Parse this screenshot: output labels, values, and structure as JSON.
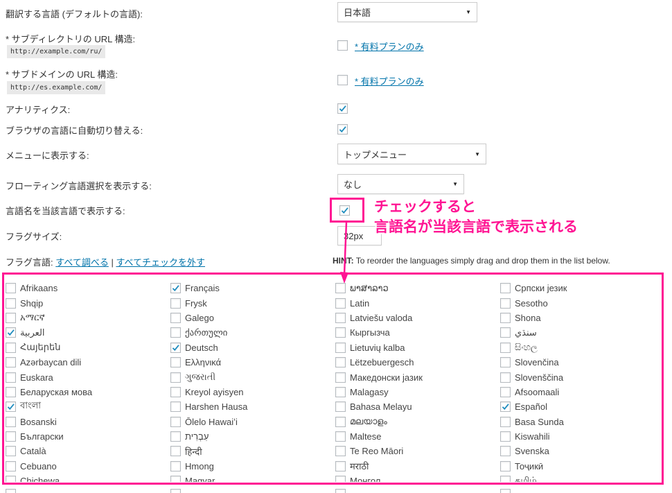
{
  "settings": {
    "translate_language": {
      "label": "翻訳する言語 (デフォルトの言語):",
      "value": "日本語"
    },
    "subdirectory": {
      "label": "* サブディレクトリの URL 構造:",
      "example": "http://example.com/ru/",
      "link": "* 有料プランのみ"
    },
    "subdomain": {
      "label": "* サブドメインの URL 構造:",
      "example": "http://es.example.com/",
      "link": "* 有料プランのみ"
    },
    "analytics": {
      "label": "アナリティクス:",
      "checked": true
    },
    "auto_switch": {
      "label": "ブラウザの言語に自動切り替える:",
      "checked": true
    },
    "menu_display": {
      "label": "メニューに表示する:",
      "value": "トップメニュー"
    },
    "floating": {
      "label": "フローティング言語選択を表示する:",
      "value": "なし"
    },
    "native_names": {
      "label": "言語名を当該言語で表示する:",
      "checked": true
    },
    "flag_size": {
      "label": "フラグサイズ:",
      "value": "32px"
    },
    "flag_languages": {
      "label": "フラグ言語:",
      "check_all": "すべて調べる",
      "separator": " | ",
      "uncheck_all": "すべてチェックを外す"
    },
    "hint": {
      "prefix": "HINT:",
      "text": " To reorder the languages simply drag and drop them in the list below."
    }
  },
  "annotation": {
    "line1": "チェックすると",
    "line2": "言語名が当該言語で表示される",
    "color": "#ff1493"
  },
  "languages": {
    "col1": [
      {
        "name": "Afrikaans",
        "checked": false
      },
      {
        "name": "Shqip",
        "checked": false
      },
      {
        "name": "አማርኛ",
        "checked": false
      },
      {
        "name": "العربية",
        "checked": true
      },
      {
        "name": "Հայերեն",
        "checked": false
      },
      {
        "name": "Azərbaycan dili",
        "checked": false
      },
      {
        "name": "Euskara",
        "checked": false
      },
      {
        "name": "Беларуская мова",
        "checked": false
      },
      {
        "name": "বাংলা",
        "checked": true
      },
      {
        "name": "Bosanski",
        "checked": false
      },
      {
        "name": "Български",
        "checked": false
      },
      {
        "name": "Català",
        "checked": false
      },
      {
        "name": "Cebuano",
        "checked": false
      },
      {
        "name": "Chichewa",
        "checked": false
      }
    ],
    "col2": [
      {
        "name": "Français",
        "checked": true
      },
      {
        "name": "Frysk",
        "checked": false
      },
      {
        "name": "Galego",
        "checked": false
      },
      {
        "name": "ქართული",
        "checked": false
      },
      {
        "name": "Deutsch",
        "checked": true
      },
      {
        "name": "Ελληνικά",
        "checked": false
      },
      {
        "name": "ગુજરાતી",
        "checked": false
      },
      {
        "name": "Kreyol ayisyen",
        "checked": false
      },
      {
        "name": "Harshen Hausa",
        "checked": false
      },
      {
        "name": "Ōlelo Hawaiʻi",
        "checked": false
      },
      {
        "name": "עִבְרִית",
        "checked": false
      },
      {
        "name": "हिन्दी",
        "checked": false
      },
      {
        "name": "Hmong",
        "checked": false
      },
      {
        "name": "Magyar",
        "checked": false
      }
    ],
    "col3": [
      {
        "name": "ພາສາລາວ",
        "checked": false
      },
      {
        "name": "Latin",
        "checked": false
      },
      {
        "name": "Latviešu valoda",
        "checked": false
      },
      {
        "name": "Кыргызча",
        "checked": false
      },
      {
        "name": "Lietuvių kalba",
        "checked": false
      },
      {
        "name": "Lëtzebuergesch",
        "checked": false
      },
      {
        "name": "Македонски јазик",
        "checked": false
      },
      {
        "name": "Malagasy",
        "checked": false
      },
      {
        "name": "Bahasa Melayu",
        "checked": false
      },
      {
        "name": "മലയാളം",
        "checked": false
      },
      {
        "name": "Maltese",
        "checked": false
      },
      {
        "name": "Te Reo Māori",
        "checked": false
      },
      {
        "name": "मराठी",
        "checked": false
      },
      {
        "name": "Монгол",
        "checked": false
      }
    ],
    "col4": [
      {
        "name": "Српски језик",
        "checked": false
      },
      {
        "name": "Sesotho",
        "checked": false
      },
      {
        "name": "Shona",
        "checked": false
      },
      {
        "name": "سنڌي",
        "checked": false
      },
      {
        "name": "සිංහල",
        "checked": false
      },
      {
        "name": "Slovenčina",
        "checked": false
      },
      {
        "name": "Slovenščina",
        "checked": false
      },
      {
        "name": "Afsoomaali",
        "checked": false
      },
      {
        "name": "Español",
        "checked": true
      },
      {
        "name": "Basa Sunda",
        "checked": false
      },
      {
        "name": "Kiswahili",
        "checked": false
      },
      {
        "name": "Svenska",
        "checked": false
      },
      {
        "name": "Тоҷикӣ",
        "checked": false
      },
      {
        "name": "தமிழ்",
        "checked": false
      }
    ]
  }
}
